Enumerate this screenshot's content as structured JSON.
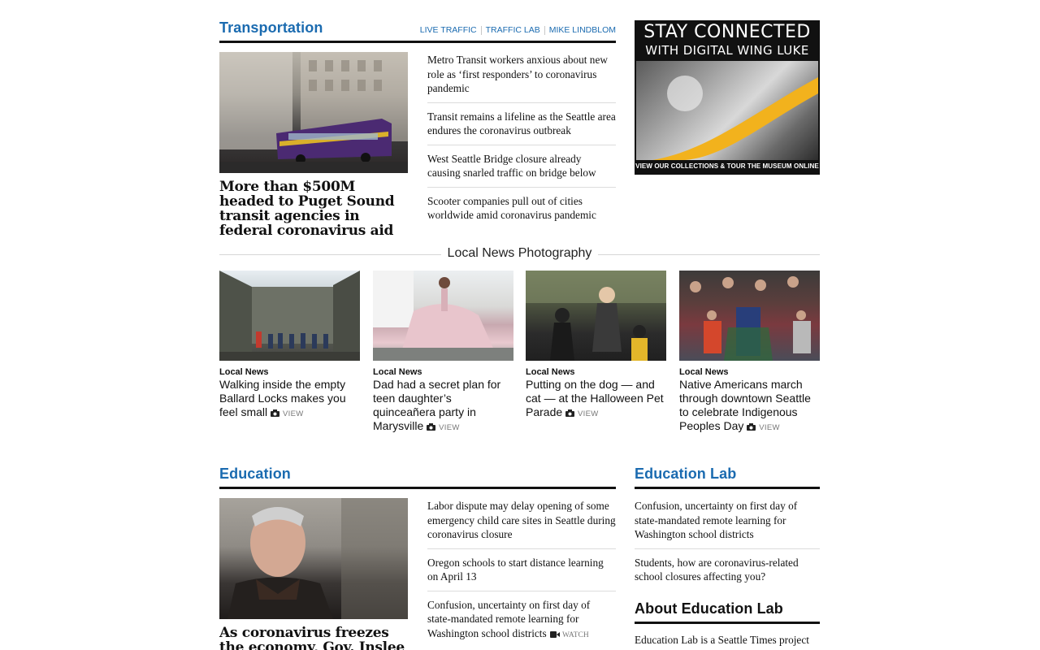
{
  "transportation": {
    "title": "Transportation",
    "links": [
      "LIVE TRAFFIC",
      "TRAFFIC LAB",
      "MIKE LINDBLOM"
    ],
    "lead_headline": "More than $500M headed to Puget Sound transit agencies in federal coronavirus aid",
    "stories": [
      "Metro Transit workers anxious about new role as ‘first responders’ to coronavirus pandemic",
      "Transit remains a lifeline as the Seattle area endures the coronavirus outbreak",
      "West Seattle Bridge closure already causing snarled traffic on bridge below",
      "Scooter companies pull out of cities worldwide amid coronavirus pandemic"
    ]
  },
  "ad": {
    "line1": "STAY CONNECTED",
    "line2": "WITH DIGITAL WING LUKE",
    "cta": "VIEW OUR COLLECTIONS & TOUR THE MUSEUM ONLINE"
  },
  "photography": {
    "title": "Local News Photography",
    "view_label": "VIEW",
    "cards": [
      {
        "kicker": "Local News",
        "caption": "Walking inside the empty Ballard Locks makes you feel small"
      },
      {
        "kicker": "Local News",
        "caption": "Dad had a secret plan for teen daughter’s quinceañera party in Marysville"
      },
      {
        "kicker": "Local News",
        "caption": "Putting on the dog — and cat — at the Halloween Pet Parade"
      },
      {
        "kicker": "Local News",
        "caption": "Native Americans march through downtown Seattle to celebrate Indigenous Peoples Day"
      }
    ]
  },
  "education": {
    "title": "Education",
    "lead_headline": "As coronavirus freezes the economy, Gov. Inslee slashes",
    "stories": [
      "Labor dispute may delay opening of some emergency child care sites in Seattle during coronavirus closure",
      "Oregon schools to start distance learning on April 13",
      "Confusion, uncertainty on first day of state-mandated remote learning for Washington school districts"
    ],
    "watch_label": "WATCH"
  },
  "education_lab": {
    "title": "Education Lab",
    "stories": [
      "Confusion, uncertainty on first day of state-mandated remote learning for Washington school districts",
      "Students, how are coronavirus-related school closures affecting you?"
    ],
    "about_title": "About Education Lab",
    "about_text": "Education Lab is a Seattle Times project"
  }
}
